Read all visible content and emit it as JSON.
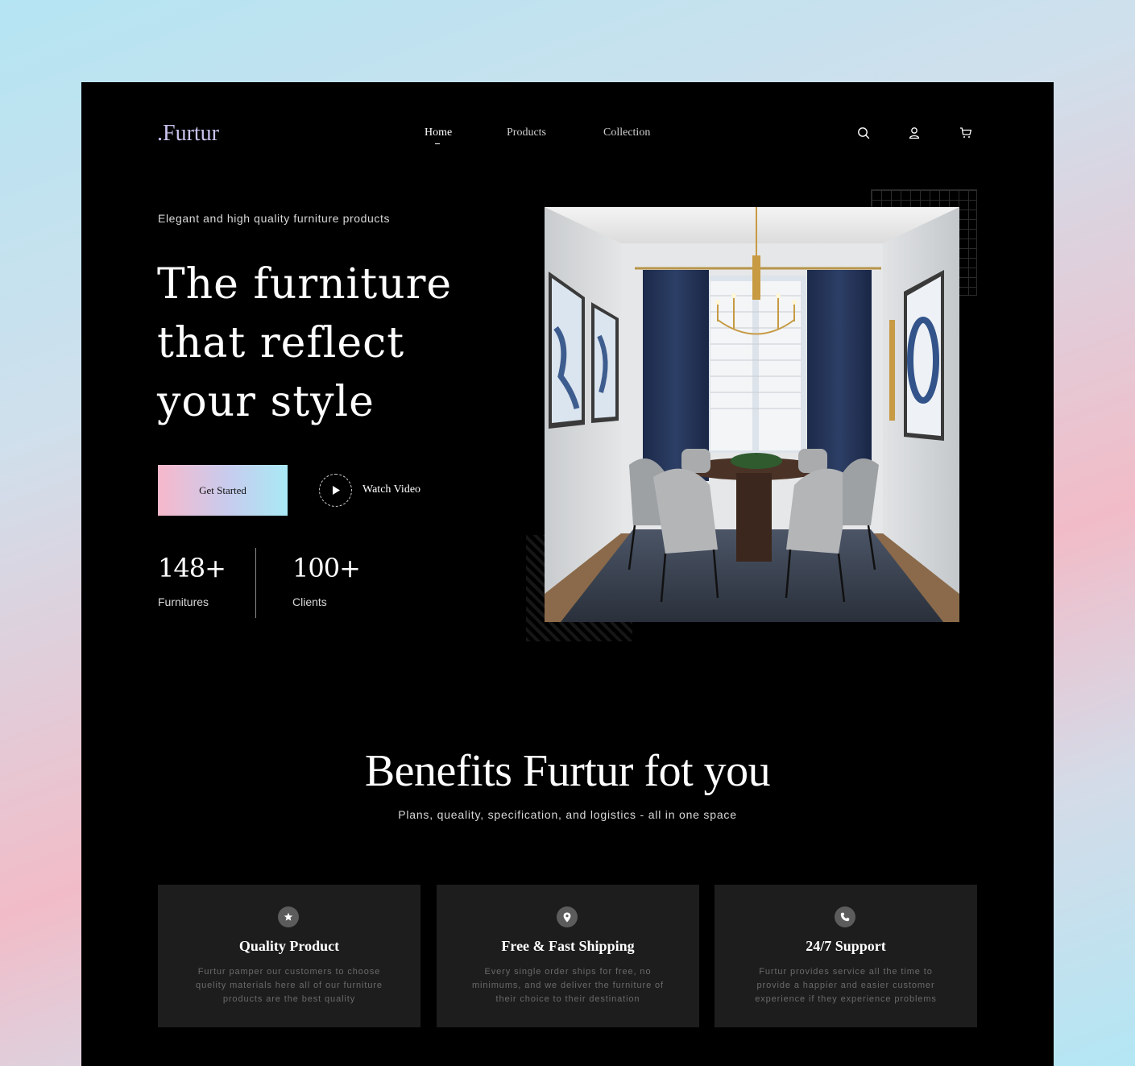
{
  "brand": {
    "logo": ".Furtur"
  },
  "nav": {
    "items": [
      {
        "label": "Home",
        "active": true
      },
      {
        "label": "Products",
        "active": false
      },
      {
        "label": "Collection",
        "active": false
      }
    ],
    "icons": [
      "search-icon",
      "user-icon",
      "cart-icon"
    ]
  },
  "hero": {
    "tagline": "Elegant and high quality furniture products",
    "title_lines": [
      "The furniture",
      "that reflect",
      "your style"
    ],
    "primary_button": "Get Started",
    "video_button": "Watch Video",
    "stats": [
      {
        "value": "148+",
        "label": "Furnitures"
      },
      {
        "value": "100+",
        "label": "Clients"
      }
    ]
  },
  "benefits": {
    "title": "Benefits Furtur fot you",
    "subtitle": "Plans, queality, specification, and logistics - all in one space",
    "cards": [
      {
        "icon": "star-icon",
        "title": "Quality Product",
        "body": "Furtur pamper our customers to choose quelity materials here all of our furniture products are the best quality"
      },
      {
        "icon": "location-pin-icon",
        "title": "Free & Fast Shipping",
        "body": "Every single order ships for free, no minimums, and we deliver the furniture of their choice to their destination"
      },
      {
        "icon": "phone-icon",
        "title": "24/7 Support",
        "body": "Furtur provides service all the time to provide a happier and easier customer experience if they experience problems"
      }
    ]
  },
  "colors": {
    "background": "#000000",
    "logo": "#c9c2ee",
    "card": "#1d1d1d",
    "button_gradient": [
      "#f7b8cb",
      "#c7ccee",
      "#a9e9f5"
    ]
  }
}
